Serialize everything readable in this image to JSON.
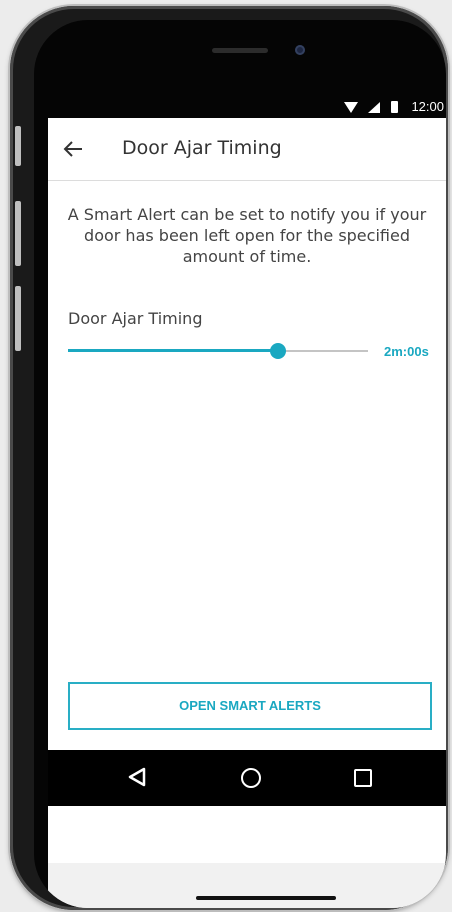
{
  "status_bar": {
    "time": "12:00",
    "icons": [
      "wifi-icon",
      "signal-icon",
      "battery-icon"
    ]
  },
  "app_bar": {
    "back_icon": "back-arrow-icon",
    "title": "Door Ajar Timing"
  },
  "description": "A Smart Alert can be set to notify you if your door has been left open for the specified amount of time.",
  "slider": {
    "label": "Door Ajar Timing",
    "value_text": "2m:00s",
    "position_fraction": 0.7
  },
  "button": {
    "label": "OPEN SMART ALERTS"
  },
  "nav_bar": {
    "icons": [
      "back-triangle-icon",
      "home-circle-icon",
      "recent-square-icon"
    ]
  },
  "colors": {
    "accent": "#1aa8c1",
    "text": "#444444",
    "title": "#333333",
    "track": "#c4c4c4",
    "nav_bg": "#000000"
  }
}
